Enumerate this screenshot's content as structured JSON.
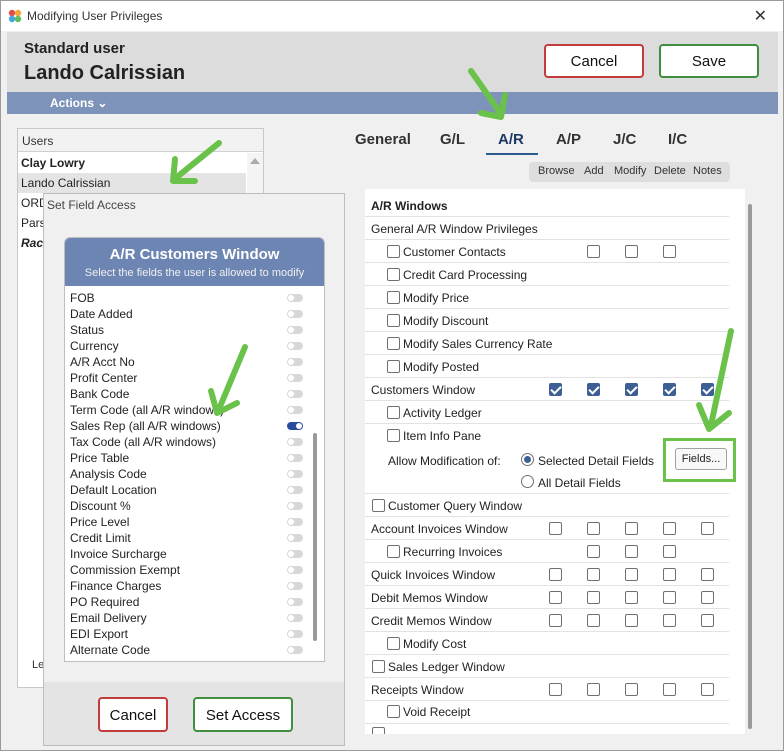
{
  "window": {
    "title": "Modifying User Privileges",
    "close": "✕"
  },
  "header": {
    "user_type": "Standard user",
    "user_name": "Lando Calrissian",
    "cancel_label": "Cancel",
    "save_label": "Save"
  },
  "actions": {
    "label": "Actions ⌄"
  },
  "users": {
    "header": "Users",
    "rows": [
      "Clay Lowry",
      "Lando Calrissian",
      "ORD",
      "Pars",
      "Rac"
    ],
    "footer": "Le"
  },
  "tabs": [
    "General",
    "G/L",
    "A/R",
    "A/P",
    "J/C",
    "I/C"
  ],
  "active_tab": "A/R",
  "sub_tabs": [
    "Browse",
    "Add",
    "Modify",
    "Delete",
    "Notes"
  ],
  "privileges": {
    "section_title": "A/R Windows",
    "rows": [
      "General A/R Window Privileges",
      "Customer Contacts",
      "Credit Card Processing",
      "Modify Price",
      "Modify Discount",
      "Modify Sales Currency Rate",
      "Modify Posted",
      "Customers Window",
      "Activity Ledger",
      "Item Info Pane",
      "Allow Modification of:",
      "Selected Detail Fields",
      "All Detail Fields",
      "Customer Query Window",
      "Account Invoices Window",
      "Recurring Invoices",
      "Quick Invoices Window",
      "Debit Memos Window",
      "Credit Memos Window",
      "Modify Cost",
      "Sales Ledger Window",
      "Receipts Window",
      "Void Receipt"
    ],
    "fields_button": "Fields..."
  },
  "dialog": {
    "title": "Set Field Access",
    "card_title": "A/R Customers Window",
    "card_subtitle": "Select the fields the user is allowed to modify",
    "fields": [
      {
        "label": "FOB",
        "on": false
      },
      {
        "label": "Date Added",
        "on": false
      },
      {
        "label": "Status",
        "on": false
      },
      {
        "label": "Currency",
        "on": false
      },
      {
        "label": "A/R Acct No",
        "on": false
      },
      {
        "label": "Profit Center",
        "on": false
      },
      {
        "label": "Bank Code",
        "on": false
      },
      {
        "label": "Term Code (all A/R windows)",
        "on": false
      },
      {
        "label": "Sales Rep (all A/R windows)",
        "on": true
      },
      {
        "label": "Tax Code (all A/R windows)",
        "on": false
      },
      {
        "label": "Price Table",
        "on": false
      },
      {
        "label": "Analysis Code",
        "on": false
      },
      {
        "label": "Default Location",
        "on": false
      },
      {
        "label": "Discount %",
        "on": false
      },
      {
        "label": "Price Level",
        "on": false
      },
      {
        "label": "Credit Limit",
        "on": false
      },
      {
        "label": "Invoice Surcharge",
        "on": false
      },
      {
        "label": "Commission Exempt",
        "on": false
      },
      {
        "label": "Finance Charges",
        "on": false
      },
      {
        "label": "PO Required",
        "on": false
      },
      {
        "label": "Email Delivery",
        "on": false
      },
      {
        "label": "EDI Export",
        "on": false
      },
      {
        "label": "Alternate Code",
        "on": false
      }
    ],
    "cancel_label": "Cancel",
    "set_access_label": "Set Access"
  },
  "colors": {
    "accent": "#6d85b3",
    "actions_bar": "#7e93ba",
    "annotation_arrow": "#6bc24a",
    "cancel_border": "#c33c3c",
    "save_border": "#3f8f3f"
  }
}
